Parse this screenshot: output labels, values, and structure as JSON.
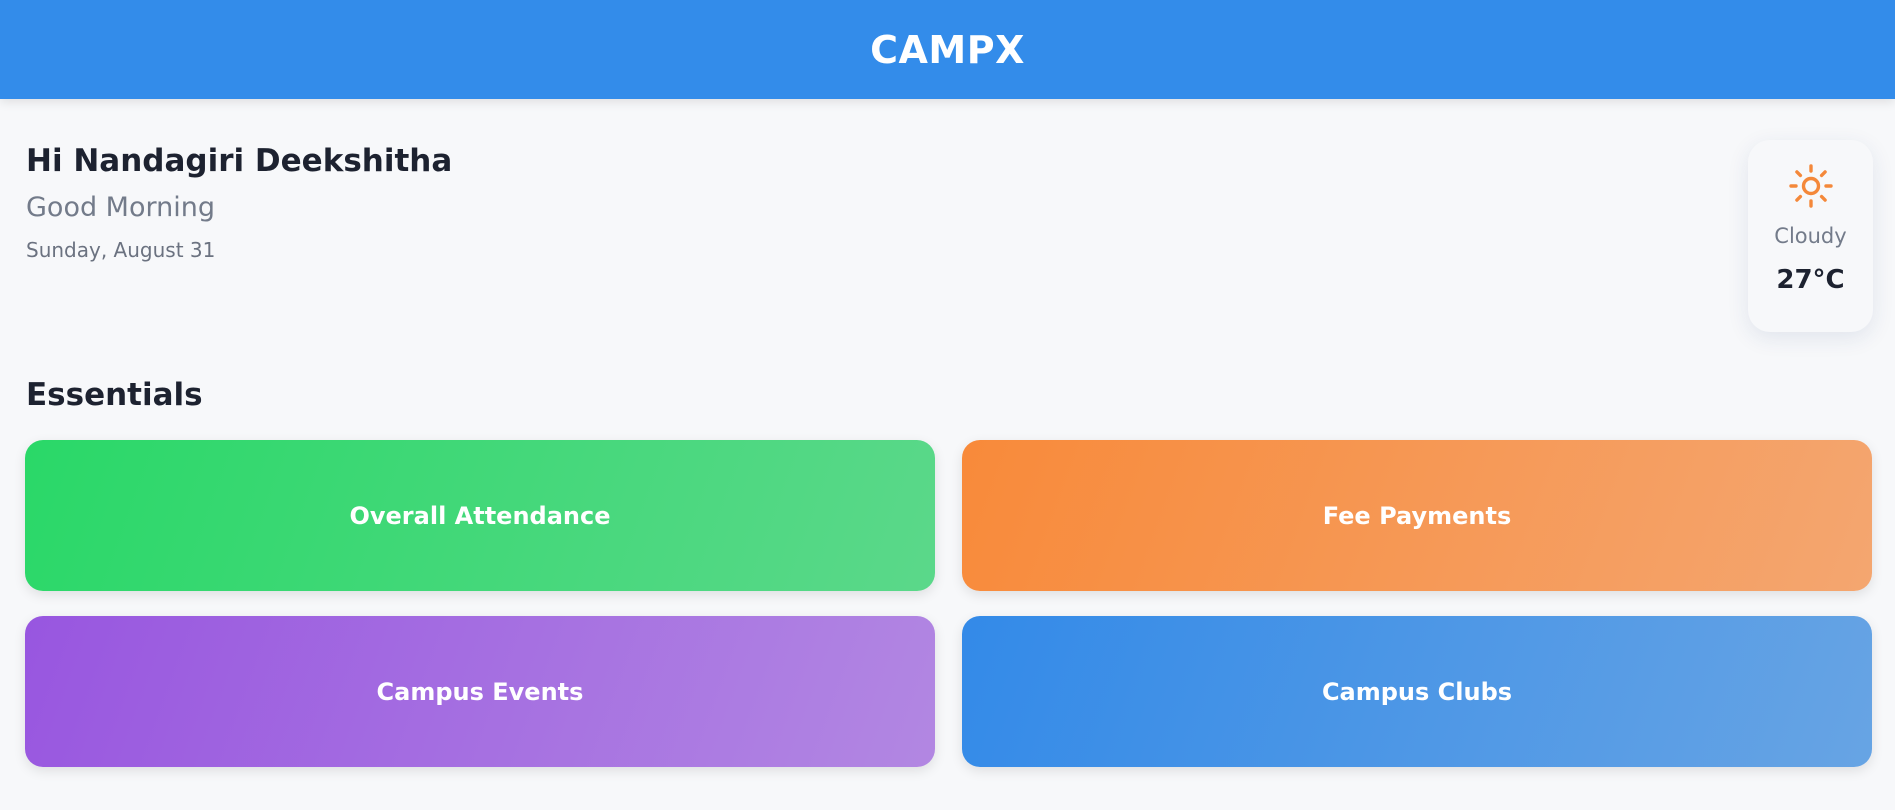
{
  "header": {
    "title": "CAMPX"
  },
  "greeting": {
    "name_line": "Hi Nandagiri Deekshitha",
    "time_of_day": "Good Morning",
    "date": "Sunday, August 31"
  },
  "weather": {
    "icon": "sun-icon",
    "condition": "Cloudy",
    "temperature": "27°C"
  },
  "essentials": {
    "title": "Essentials",
    "tiles": [
      {
        "label": "Overall Attendance",
        "color_start": "#2ad868",
        "color_end": "#5bd88a"
      },
      {
        "label": "Fee Payments",
        "color_start": "#f88a3a",
        "color_end": "#f4a670"
      },
      {
        "label": "Campus Events",
        "color_start": "#9856e0",
        "color_end": "#b287e2"
      },
      {
        "label": "Campus Clubs",
        "color_start": "#338ae8",
        "color_end": "#67a4e4"
      }
    ]
  },
  "colors": {
    "header_bg": "#338cea",
    "page_bg": "#f7f8fa",
    "sun_icon": "#f4883a"
  }
}
